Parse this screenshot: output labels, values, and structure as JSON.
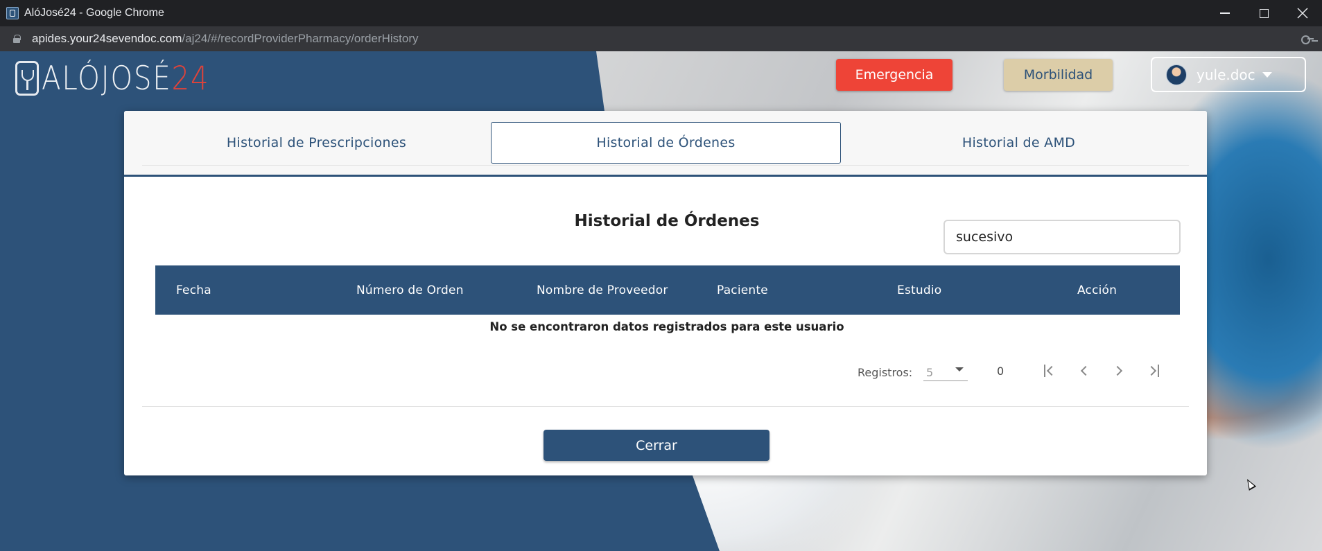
{
  "window": {
    "title": "AlóJosé24 - Google Chrome",
    "icon": "app-favicon"
  },
  "address_bar": {
    "host": "apides.your24sevendoc.com",
    "path": "/aj24/#/recordProviderPharmacy/orderHistory"
  },
  "header": {
    "logo_text": "ALÓJOSÉ",
    "logo_number": "24",
    "emergency_label": "Emergencia",
    "morbidity_label": "Morbilidad",
    "user_name": "yule.doc"
  },
  "tabs": [
    {
      "label": "Historial de Prescripciones",
      "active": false
    },
    {
      "label": "Historial de Órdenes",
      "active": true
    },
    {
      "label": "Historial de AMD",
      "active": false
    }
  ],
  "content": {
    "title": "Historial de Órdenes",
    "search_value": "sucesivo",
    "columns": [
      "Fecha",
      "Número de Orden",
      "Nombre de Proveedor",
      "Paciente",
      "Estudio",
      "Acción"
    ],
    "empty_message": "No se encontraron datos registrados para este usuario"
  },
  "paginator": {
    "label": "Registros:",
    "page_size": "5",
    "count": "0"
  },
  "footer": {
    "close_label": "Cerrar"
  },
  "colors": {
    "primary": "#2d5279",
    "emergency": "#ee4437",
    "morbidity": "#dccda8"
  }
}
